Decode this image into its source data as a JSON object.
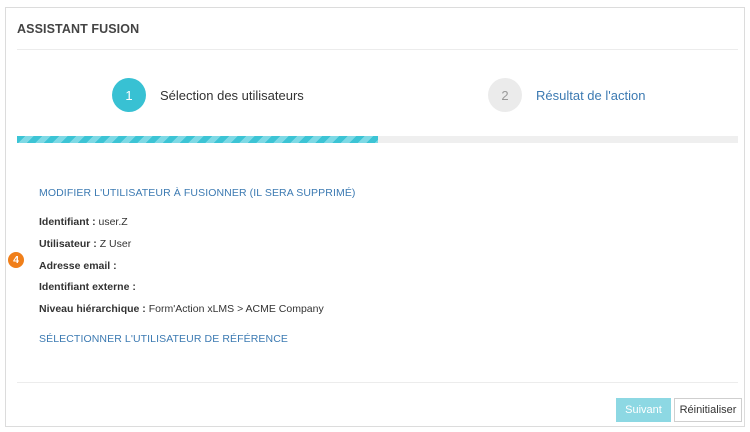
{
  "panel": {
    "title": "ASSISTANT FUSION"
  },
  "steps": [
    {
      "number": "1",
      "label": "Sélection des utilisateurs",
      "state": "active"
    },
    {
      "number": "2",
      "label": "Résultat de l'action",
      "state": "inactive"
    }
  ],
  "progress": {
    "percent": 50
  },
  "modify_link": "MODIFIER L'UTILISATEUR À FUSIONNER (IL SERA SUPPRIMÉ)",
  "fields": [
    {
      "label": "Identifiant :",
      "value": "user.Z"
    },
    {
      "label": "Utilisateur :",
      "value": "Z User"
    },
    {
      "label": "Adresse email :",
      "value": ""
    },
    {
      "label": "Identifiant externe :",
      "value": ""
    },
    {
      "label": "Niveau hiérarchique :",
      "value": "Form'Action xLMS > ACME Company"
    }
  ],
  "callout": {
    "number": "4"
  },
  "select_link": "SÉLECTIONNER L'UTILISATEUR DE RÉFÉRENCE",
  "buttons": {
    "next": "Suivant",
    "reset": "Réinitialiser"
  },
  "colors": {
    "accent": "#38c1d3",
    "link": "#3c7ab2",
    "callout": "#f07f1a"
  }
}
